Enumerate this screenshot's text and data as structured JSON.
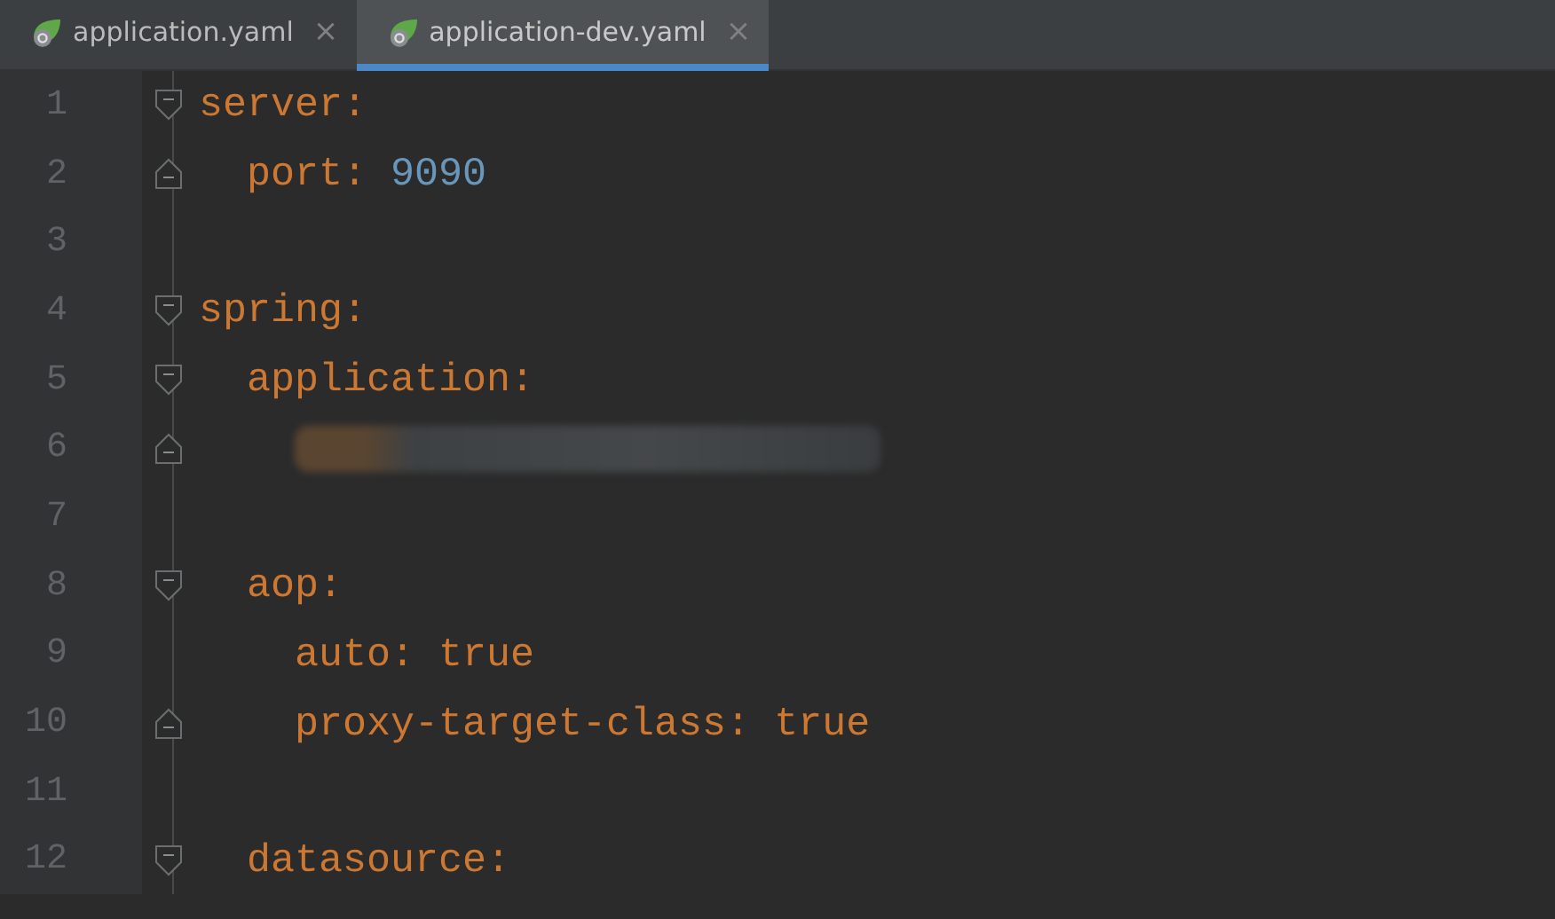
{
  "tabs": [
    {
      "label": "application.yaml",
      "selected": false,
      "close": "×"
    },
    {
      "label": "application-dev.yaml",
      "selected": true,
      "close": "×"
    }
  ],
  "editor": {
    "lines": [
      {
        "number": "1",
        "kind": "pair",
        "fold_start": true,
        "key": "server",
        "colon": ":",
        "children": [
          {
            "number": "2",
            "kind": "pair",
            "fold_end": true,
            "key": "port",
            "colon": ":",
            "value": {
              "text": "9090",
              "kind": "number"
            }
          }
        ]
      },
      {
        "number": "3",
        "kind": "blank"
      },
      {
        "number": "4",
        "kind": "pair",
        "fold_start": true,
        "key": "spring",
        "colon": ":",
        "children": [
          {
            "number": "5",
            "kind": "pair",
            "fold_start": true,
            "key": "application",
            "colon": ":",
            "children": [
              {
                "number": "6",
                "kind": "redacted",
                "fold_end": true
              }
            ]
          },
          {
            "number": "7",
            "kind": "blank"
          },
          {
            "number": "8",
            "kind": "pair",
            "fold_start": true,
            "key": "aop",
            "colon": ":",
            "children": [
              {
                "number": "9",
                "kind": "pair",
                "key": "auto",
                "colon": ":",
                "value": {
                  "text": "true",
                  "kind": "keyword"
                }
              },
              {
                "number": "10",
                "kind": "pair",
                "fold_end": true,
                "key": "proxy-target-class",
                "colon": ":",
                "value": {
                  "text": "true",
                  "kind": "keyword"
                }
              }
            ]
          },
          {
            "number": "11",
            "kind": "blank"
          },
          {
            "number": "12",
            "kind": "pair",
            "fold_start": true,
            "key": "datasource",
            "colon": ":"
          }
        ]
      }
    ]
  }
}
